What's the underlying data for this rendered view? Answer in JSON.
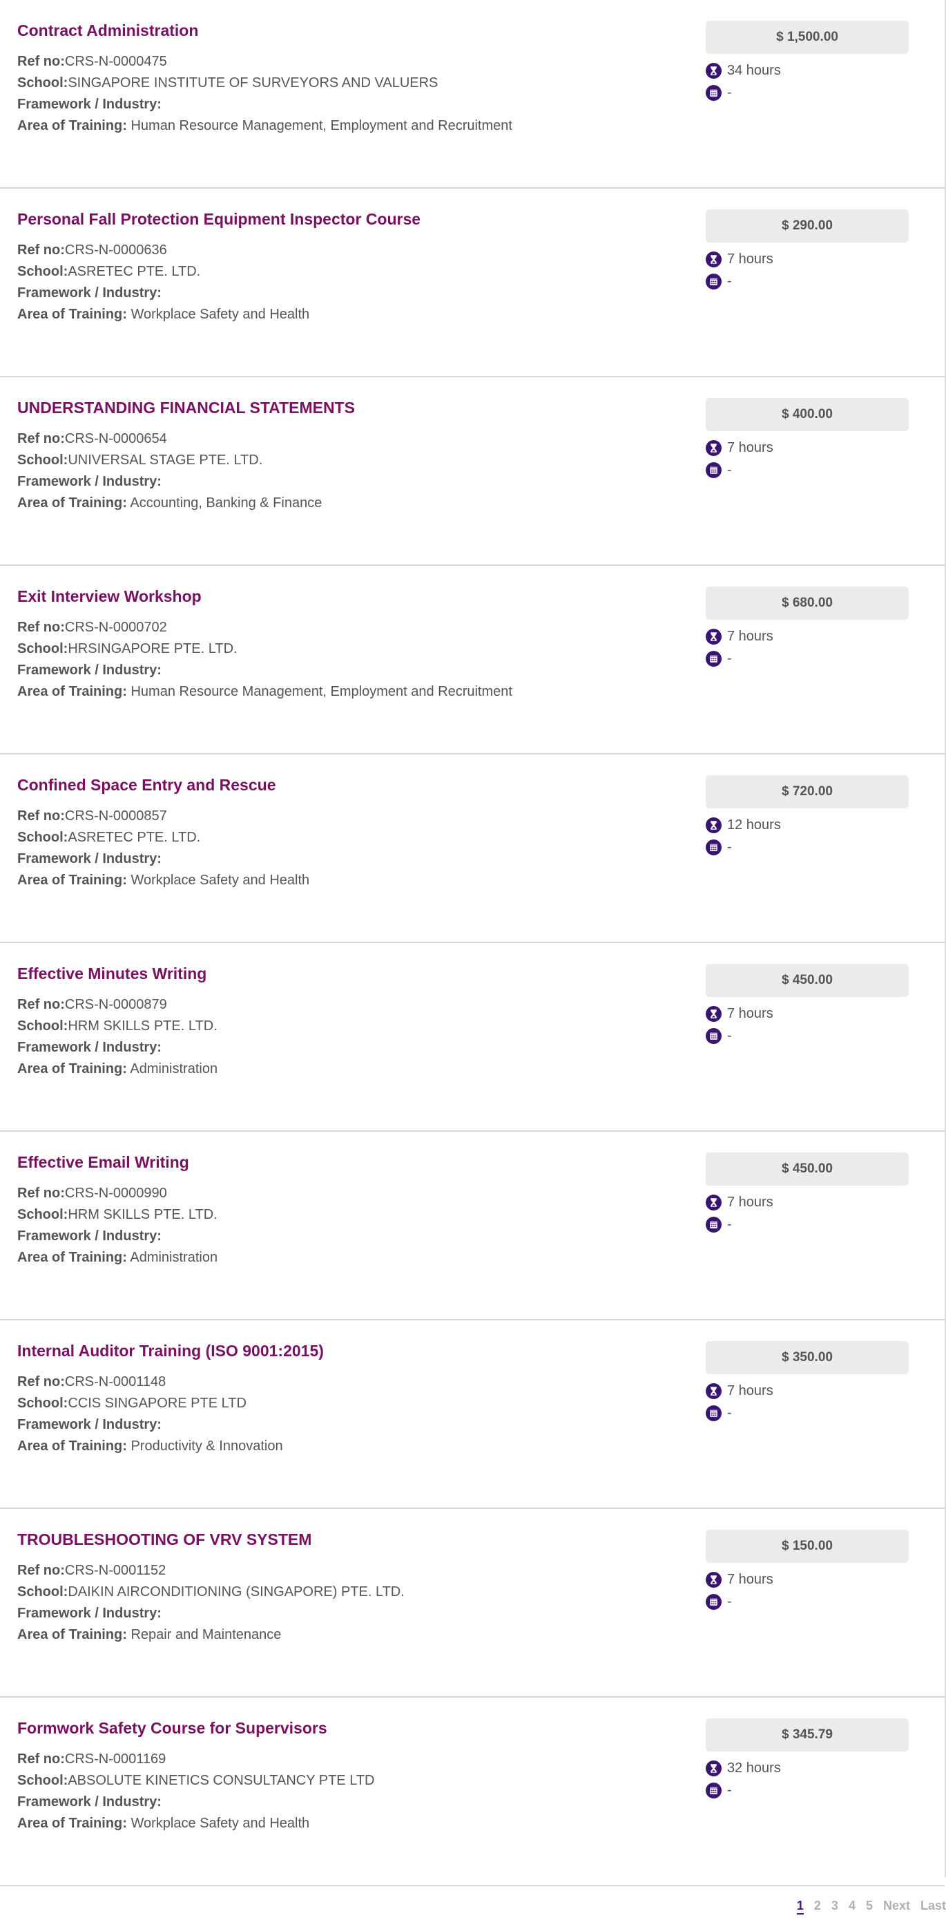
{
  "labels": {
    "ref_no": "Ref no:",
    "school": "School:",
    "framework": "Framework / Industry:",
    "area": "Area of Training:"
  },
  "icons": {
    "duration": "hourglass-icon",
    "date": "calendar-icon",
    "icon_color": "#3a1570"
  },
  "colors": {
    "title": "#7a1060",
    "active_page": "#4a1a7a"
  },
  "courses": [
    {
      "title": "Contract Administration",
      "ref": "CRS-N-0000475",
      "school": "SINGAPORE INSTITUTE OF SURVEYORS AND VALUERS",
      "framework": "",
      "area": "Human Resource Management, Employment and Recruitment",
      "price": "$ 1,500.00",
      "duration": "34 hours",
      "date": "-"
    },
    {
      "title": "Personal Fall Protection Equipment Inspector Course",
      "ref": "CRS-N-0000636",
      "school": "ASRETEC PTE. LTD.",
      "framework": "",
      "area": "Workplace Safety and Health",
      "price": "$ 290.00",
      "duration": "7 hours",
      "date": "-"
    },
    {
      "title": "UNDERSTANDING FINANCIAL STATEMENTS",
      "ref": "CRS-N-0000654",
      "school": "UNIVERSAL STAGE PTE. LTD.",
      "framework": "",
      "area": "Accounting, Banking & Finance",
      "price": "$ 400.00",
      "duration": "7 hours",
      "date": "-"
    },
    {
      "title": "Exit Interview Workshop",
      "ref": "CRS-N-0000702",
      "school": "HRSINGAPORE PTE. LTD.",
      "framework": "",
      "area": "Human Resource Management, Employment and Recruitment",
      "price": "$ 680.00",
      "duration": "7 hours",
      "date": "-"
    },
    {
      "title": "Confined Space Entry and Rescue",
      "ref": "CRS-N-0000857",
      "school": "ASRETEC PTE. LTD.",
      "framework": "",
      "area": "Workplace Safety and Health",
      "price": "$ 720.00",
      "duration": "12 hours",
      "date": "-"
    },
    {
      "title": "Effective Minutes Writing",
      "ref": "CRS-N-0000879",
      "school": "HRM SKILLS PTE. LTD.",
      "framework": "",
      "area": "Administration",
      "price": "$ 450.00",
      "duration": "7 hours",
      "date": "-"
    },
    {
      "title": "Effective Email Writing",
      "ref": "CRS-N-0000990",
      "school": "HRM SKILLS PTE. LTD.",
      "framework": "",
      "area": "Administration",
      "price": "$ 450.00",
      "duration": "7 hours",
      "date": "-"
    },
    {
      "title": "Internal Auditor Training (ISO 9001:2015)",
      "ref": "CRS-N-0001148",
      "school": "CCIS SINGAPORE PTE LTD",
      "framework": "",
      "area": "Productivity & Innovation",
      "price": "$ 350.00",
      "duration": "7 hours",
      "date": "-"
    },
    {
      "title": "TROUBLESHOOTING OF VRV SYSTEM",
      "ref": "CRS-N-0001152",
      "school": "DAIKIN AIRCONDITIONING (SINGAPORE) PTE. LTD.",
      "framework": "",
      "area": "Repair and Maintenance",
      "price": "$ 150.00",
      "duration": "7 hours",
      "date": "-"
    },
    {
      "title": "Formwork Safety Course for Supervisors",
      "ref": "CRS-N-0001169",
      "school": "ABSOLUTE KINETICS CONSULTANCY PTE LTD",
      "framework": "",
      "area": "Workplace Safety and Health",
      "price": "$ 345.79",
      "duration": "32 hours",
      "date": "-"
    }
  ],
  "pagination": {
    "pages": [
      "1",
      "2",
      "3",
      "4",
      "5"
    ],
    "current": "1",
    "next": "Next",
    "last": "Last"
  }
}
